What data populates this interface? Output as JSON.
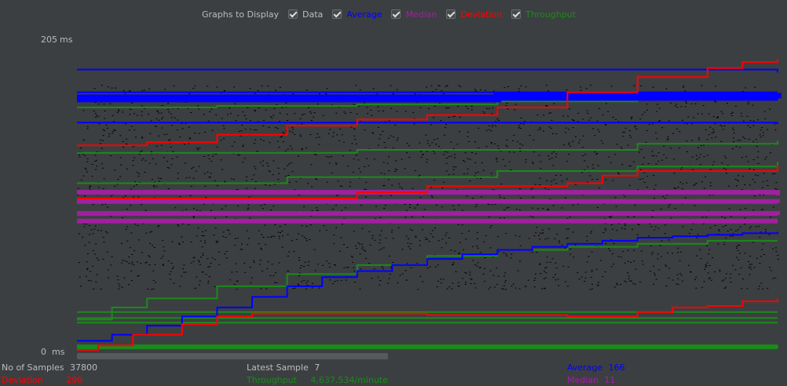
{
  "legend": {
    "title": "Graphs to Display",
    "items": [
      {
        "key": "data",
        "label": "Data",
        "color": "#bbbbbb",
        "checked": true
      },
      {
        "key": "average",
        "label": "Average",
        "color": "#0000ff",
        "checked": true
      },
      {
        "key": "median",
        "label": "Median",
        "color": "#a020a0",
        "checked": true
      },
      {
        "key": "deviation",
        "label": "Deviation",
        "color": "#ff0000",
        "checked": true
      },
      {
        "key": "throughput",
        "label": "Throughput",
        "color": "#1a8a1a",
        "checked": true
      }
    ]
  },
  "axis": {
    "top_value": "205",
    "top_unit": "ms",
    "bottom_value": "0",
    "bottom_unit": "ms"
  },
  "stats": {
    "samples_label": "No of Samples",
    "samples_value": "37800",
    "latest_label": "Latest Sample",
    "latest_value": "7",
    "average_label": "Average",
    "average_value": "166",
    "deviation_label": "Deviation",
    "deviation_value": "290",
    "throughput_label": "Throughput",
    "throughput_value": "4,637.534/minute",
    "median_label": "Median",
    "median_value": "11"
  },
  "colors": {
    "background": "#3c3f41",
    "data": "#000000",
    "average": "#0000ff",
    "median": "#a020a0",
    "deviation": "#ff0000",
    "throughput": "#1a8a1a"
  },
  "chart_data": {
    "type": "line",
    "title": "",
    "xlabel": "",
    "ylabel": "",
    "ylim": [
      0,
      205
    ],
    "grid": false,
    "legend_position": "top-center",
    "series": [
      {
        "name": "Average",
        "color": "#0000ff",
        "style": "step",
        "lines": [
          [
            [
              0,
              6
            ],
            [
              5,
              10
            ],
            [
              10,
              16
            ],
            [
              15,
              22
            ],
            [
              20,
              28
            ],
            [
              25,
              35
            ],
            [
              30,
              42
            ],
            [
              35,
              48
            ],
            [
              40,
              52
            ],
            [
              45,
              56
            ],
            [
              50,
              60
            ],
            [
              55,
              63
            ],
            [
              60,
              66
            ],
            [
              65,
              68
            ],
            [
              70,
              70
            ],
            [
              75,
              72
            ],
            [
              80,
              74
            ],
            [
              85,
              75
            ],
            [
              90,
              76
            ],
            [
              95,
              77
            ],
            [
              100,
              78
            ]
          ],
          [
            [
              0,
              166
            ],
            [
              30,
              166
            ],
            [
              60,
              167
            ],
            [
              100,
              166
            ]
          ],
          [
            [
              0,
              150
            ],
            [
              50,
              150
            ],
            [
              100,
              149
            ]
          ],
          [
            [
              0,
              167
            ],
            [
              40,
              167
            ],
            [
              80,
              166
            ],
            [
              100,
              165
            ]
          ],
          [
            [
              0,
              185
            ],
            [
              100,
              183
            ]
          ],
          [
            [
              0,
              170
            ],
            [
              100,
              170
            ]
          ]
        ]
      },
      {
        "name": "Median",
        "color": "#a020a0",
        "style": "band",
        "lines": [
          [
            [
              0,
              98
            ],
            [
              100,
              97
            ]
          ],
          [
            [
              0,
              90
            ],
            [
              100,
              89
            ]
          ],
          [
            [
              0,
              85
            ],
            [
              100,
              85
            ]
          ],
          [
            [
              0,
              104
            ],
            [
              100,
              102
            ]
          ]
        ]
      },
      {
        "name": "Deviation",
        "color": "#ff0000",
        "style": "step",
        "lines": [
          [
            [
              0,
              0
            ],
            [
              3,
              3
            ],
            [
              8,
              10
            ],
            [
              15,
              17
            ],
            [
              20,
              22
            ],
            [
              25,
              24
            ],
            [
              50,
              23
            ],
            [
              70,
              22
            ],
            [
              80,
              25
            ],
            [
              85,
              28
            ],
            [
              90,
              29
            ],
            [
              95,
              32
            ],
            [
              100,
              34
            ]
          ],
          [
            [
              0,
              135
            ],
            [
              10,
              137
            ],
            [
              20,
              142
            ],
            [
              30,
              148
            ],
            [
              40,
              152
            ],
            [
              50,
              155
            ],
            [
              60,
              160
            ],
            [
              70,
              170
            ],
            [
              80,
              180
            ],
            [
              90,
              186
            ],
            [
              95,
              190
            ],
            [
              100,
              192
            ]
          ],
          [
            [
              0,
              100
            ],
            [
              20,
              100
            ],
            [
              40,
              104
            ],
            [
              50,
              108
            ],
            [
              60,
              108
            ],
            [
              70,
              110
            ],
            [
              75,
              115
            ],
            [
              80,
              118
            ],
            [
              100,
              122
            ]
          ]
        ]
      },
      {
        "name": "Throughput",
        "color": "#1a8a1a",
        "style": "step",
        "lines": [
          [
            [
              0,
              2
            ],
            [
              100,
              3
            ]
          ],
          [
            [
              0,
              20
            ],
            [
              5,
              28
            ],
            [
              10,
              34
            ],
            [
              20,
              42
            ],
            [
              30,
              50
            ],
            [
              40,
              56
            ],
            [
              50,
              62
            ],
            [
              60,
              66
            ],
            [
              70,
              68
            ],
            [
              80,
              70
            ],
            [
              90,
              72
            ],
            [
              100,
              72
            ]
          ],
          [
            [
              0,
              160
            ],
            [
              20,
              161
            ],
            [
              40,
              162
            ],
            [
              60,
              164
            ],
            [
              80,
              166
            ],
            [
              100,
              168
            ]
          ],
          [
            [
              0,
              110
            ],
            [
              30,
              114
            ],
            [
              60,
              118
            ],
            [
              80,
              121
            ],
            [
              100,
              124
            ]
          ],
          [
            [
              0,
              130
            ],
            [
              40,
              132
            ],
            [
              80,
              136
            ],
            [
              100,
              138
            ]
          ],
          [
            [
              0,
              25
            ],
            [
              100,
              25
            ]
          ],
          [
            [
              0,
              21
            ],
            [
              100,
              21
            ]
          ],
          [
            [
              0,
              18
            ],
            [
              100,
              18
            ]
          ]
        ]
      },
      {
        "name": "Data",
        "color": "#000000",
        "style": "scatter-dense",
        "range": [
          40,
          175
        ]
      }
    ]
  }
}
